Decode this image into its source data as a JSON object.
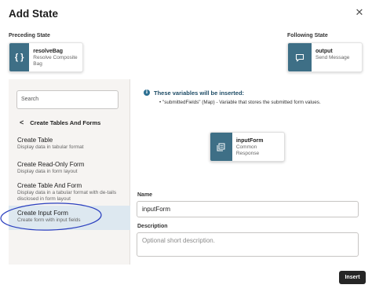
{
  "dialog": {
    "title": "Add State",
    "close_glyph": "✕"
  },
  "preceding": {
    "label": "Preceding State",
    "name": "resolveBag",
    "type": "Resolve Composite Bag",
    "icon": "curly-braces-icon",
    "icon_glyph": "{ }"
  },
  "following": {
    "label": "Following State",
    "name": "output",
    "type": "Send Message",
    "icon": "chat-bubble-icon"
  },
  "search": {
    "placeholder": "Search"
  },
  "category": {
    "back_glyph": "<",
    "title": "Create Tables And Forms"
  },
  "options": [
    {
      "title": "Create Table",
      "desc": "Display data in tabular format"
    },
    {
      "title": "Create Read-Only Form",
      "desc": "Display data in form layout"
    },
    {
      "title": "Create Table And Form",
      "desc": "Display data in a tabular format with de-tails disclosed in form layout"
    },
    {
      "title": "Create Input Form",
      "desc": "Create form with input fields",
      "selected": true
    }
  ],
  "info": {
    "icon_glyph": "i",
    "title": "These variables will be inserted:",
    "bullet": "•  \"submittedFields\" (Map) - Variable that stores the submitted form values."
  },
  "new_state": {
    "name": "inputForm",
    "type": "Common Response",
    "icon": "form-icon"
  },
  "form": {
    "name_label": "Name",
    "name_value": "inputForm",
    "desc_label": "Description",
    "desc_placeholder": "Optional short description."
  },
  "footer": {
    "insert_label": "Insert"
  },
  "colors": {
    "state_icon_bg": "#3e6f86",
    "selection_bg": "#dde8f0",
    "highlight_oval": "#2a3fbf",
    "info_blue": "#2b6f92"
  }
}
